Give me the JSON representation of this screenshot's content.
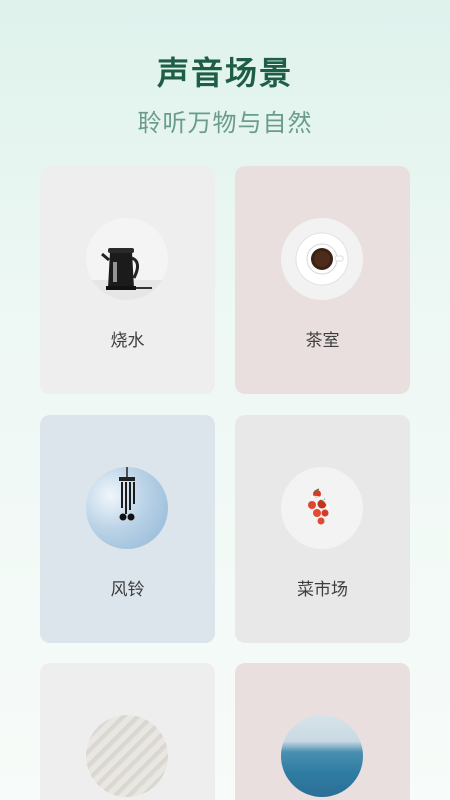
{
  "header": {
    "title": "声音场景",
    "subtitle": "聆听万物与自然"
  },
  "scenes": [
    {
      "label": "烧水",
      "icon": "kettle-icon",
      "bg": "#efeeee"
    },
    {
      "label": "茶室",
      "icon": "coffee-cup-icon",
      "bg": "#eadfdf"
    },
    {
      "label": "风铃",
      "icon": "wind-chime-icon",
      "bg": "#dce4ec"
    },
    {
      "label": "菜市场",
      "icon": "tomatoes-icon",
      "bg": "#e8e8e8"
    },
    {
      "label": "",
      "icon": "sand-icon",
      "bg": "#eeeeee"
    },
    {
      "label": "",
      "icon": "sea-icon",
      "bg": "#eadfdf"
    }
  ],
  "colors": {
    "title": "#1f5e46",
    "subtitle": "#6a9c89"
  }
}
